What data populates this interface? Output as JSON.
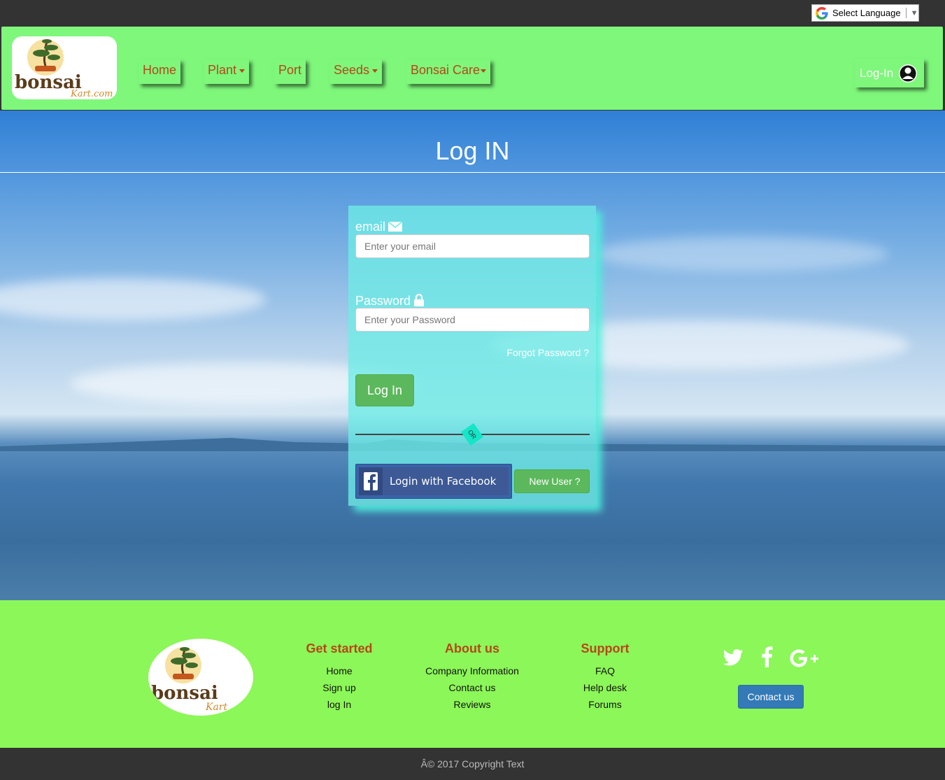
{
  "topbar": {
    "language_select": "Select Language",
    "arrow": "▼"
  },
  "navbar": {
    "logo_text": "bonsai",
    "logo_subtext": "Kart.com",
    "items": [
      {
        "label": "Home",
        "dropdown": false
      },
      {
        "label": "Plant",
        "dropdown": true
      },
      {
        "label": "Port",
        "dropdown": false
      },
      {
        "label": "Seeds",
        "dropdown": true
      },
      {
        "label": "Bonsai Care",
        "dropdown": true
      }
    ],
    "login_label": "Log-In"
  },
  "hero": {
    "title": "Log IN"
  },
  "login_form": {
    "email_label": "email",
    "email_placeholder": "Enter your email",
    "password_label": "Password",
    "password_placeholder": "Enter your Password",
    "forgot_label": "Forgot Password ?",
    "submit_label": "Log In",
    "or_label": "OR",
    "facebook_label": "Login with Facebook",
    "new_user_label": "New User ?"
  },
  "footer": {
    "logo_text": "bonsai",
    "logo_subtext": "Kart",
    "columns": [
      {
        "title": "Get started",
        "links": [
          "Home",
          "Sign up",
          "log In"
        ]
      },
      {
        "title": "About us",
        "links": [
          "Company Information",
          "Contact us",
          "Reviews"
        ]
      },
      {
        "title": "Support",
        "links": [
          "FAQ",
          "Help desk",
          "Forums"
        ]
      }
    ],
    "social_icons": [
      "twitter-icon",
      "facebook-icon",
      "google-plus-icon"
    ],
    "contact_button": "Contact us"
  },
  "copyright": "Â© 2017 Copyright Text",
  "colors": {
    "nav_bg": "#7ef77b",
    "nav_text": "#b5471a",
    "footer_bg": "#8cf758",
    "form_panel": "#6eece6",
    "button_green": "#5cb85c",
    "facebook_blue": "#3b5998",
    "contact_blue": "#337ab7"
  }
}
